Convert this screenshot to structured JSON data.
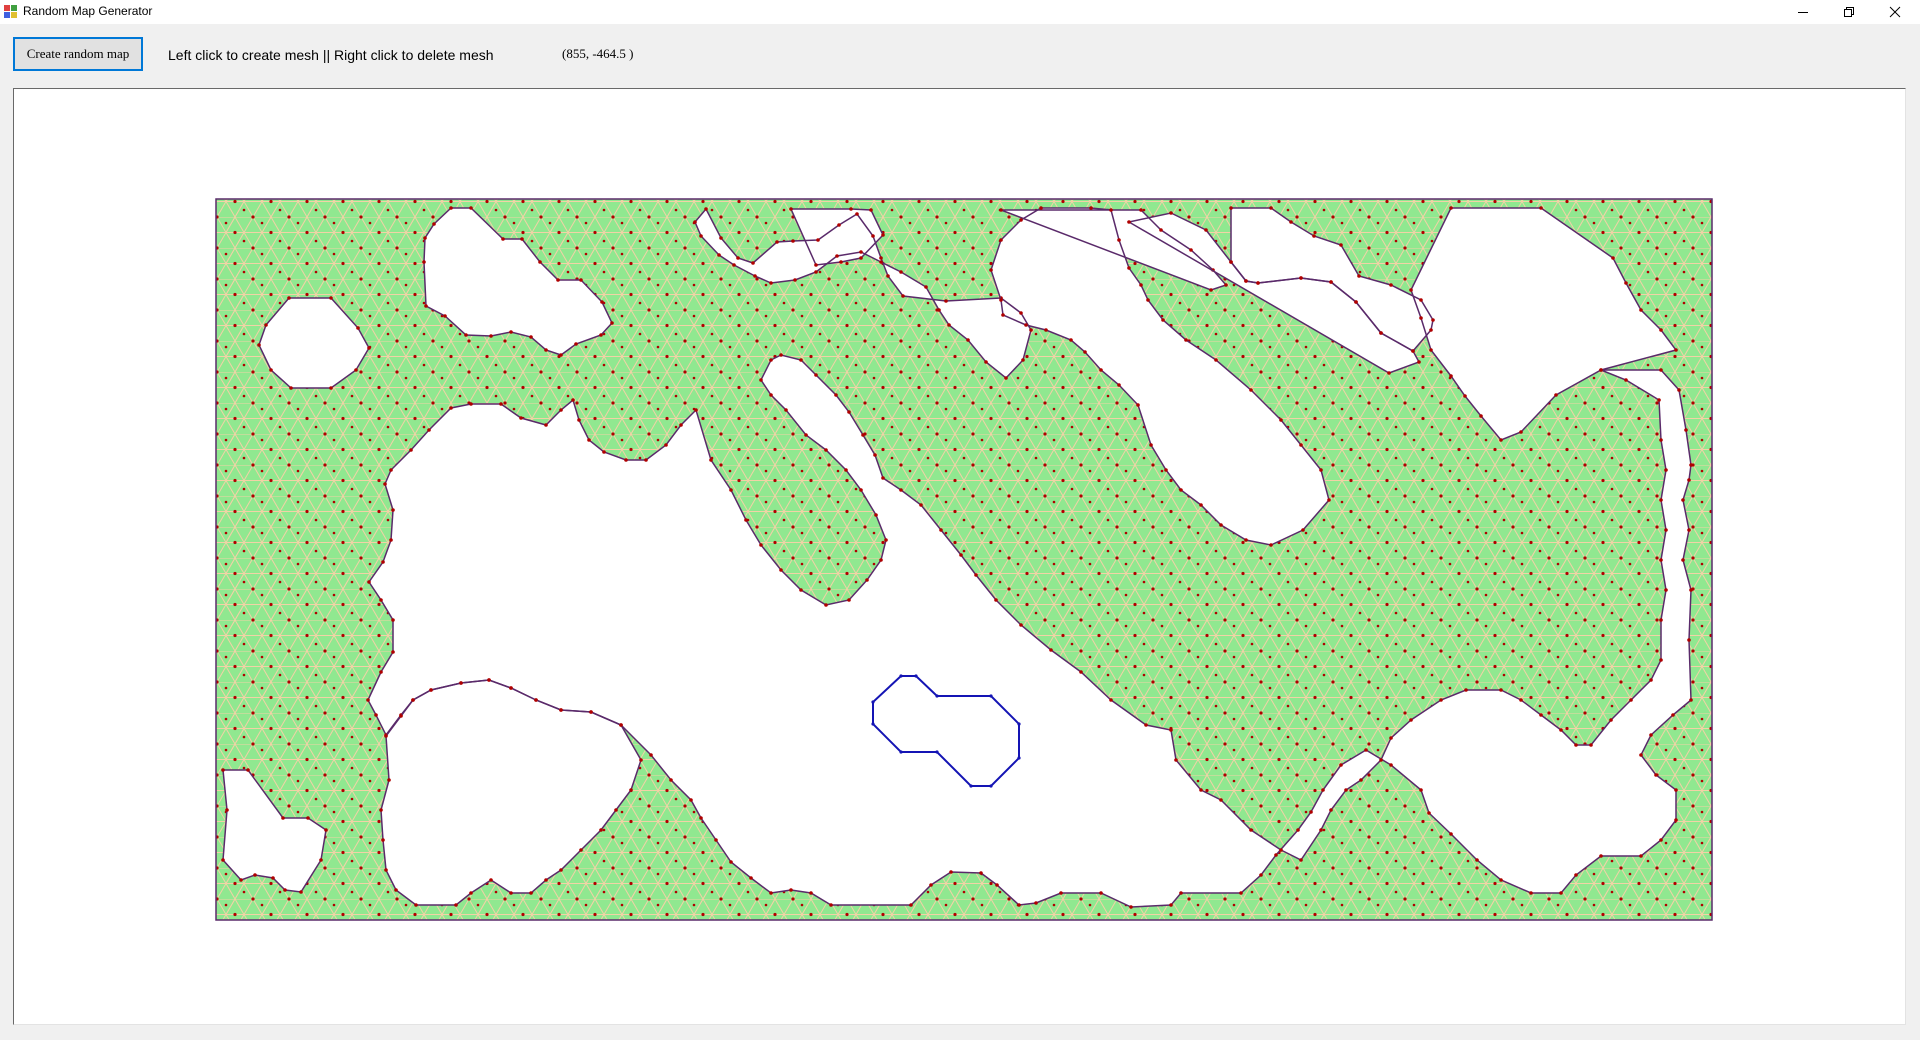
{
  "window": {
    "title": "Random Map Generator",
    "minimize_icon": "minimize-icon",
    "restore_icon": "restore-icon",
    "close_icon": "close-icon"
  },
  "toolbar": {
    "create_button_label": "Create random map",
    "instructions": "Left click to create mesh || Right click to delete mesh",
    "cursor_coords": "(855, -464.5 )"
  },
  "colors": {
    "mesh_fill": "#90e890",
    "mesh_edge": "#f0c8a0",
    "vertex": "#b00000",
    "boundary": "#5a2a6a",
    "selected_outline": "#1414b4",
    "selection_button_border": "#0078d7"
  }
}
